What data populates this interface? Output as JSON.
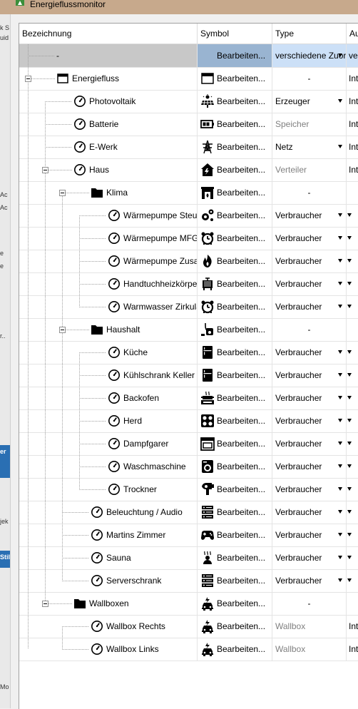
{
  "window": {
    "title": "Energieflussmonitor"
  },
  "columns": [
    "Bezeichnung",
    "Symbol",
    "Type",
    "Au"
  ],
  "rows": [
    {
      "label": "-",
      "symbol": "",
      "edit": "Bearbeiten...",
      "type": "verschiedene Zuordnungen",
      "type_style": "normal",
      "dropdown": true,
      "col4": "ve",
      "col4_dropdown": false
    },
    {
      "label": "Energiefluss",
      "symbol": "window-icon",
      "edit": "Bearbeiten...",
      "type": "-",
      "type_style": "center",
      "dropdown": false,
      "col4": "Int",
      "col4_dropdown": false
    },
    {
      "label": "Photovoltaik",
      "symbol": "solar-panel-icon",
      "edit": "Bearbeiten...",
      "type": "Erzeuger",
      "type_style": "normal",
      "dropdown": true,
      "col4": "Int",
      "col4_dropdown": false
    },
    {
      "label": "Batterie",
      "symbol": "battery-icon",
      "edit": "Bearbeiten...",
      "type": "Speicher",
      "type_style": "gray",
      "dropdown": false,
      "col4": "Int",
      "col4_dropdown": false
    },
    {
      "label": "E-Werk",
      "symbol": "power-tower-icon",
      "edit": "Bearbeiten...",
      "type": "Netz",
      "type_style": "normal",
      "dropdown": true,
      "col4": "Int",
      "col4_dropdown": false
    },
    {
      "label": "Haus",
      "symbol": "house-icon",
      "edit": "Bearbeiten...",
      "type": "Verteiler",
      "type_style": "gray",
      "dropdown": false,
      "col4": "Int",
      "col4_dropdown": false
    },
    {
      "label": "Klima",
      "symbol": "fireplace-icon",
      "edit": "Bearbeiten...",
      "type": "-",
      "type_style": "center",
      "dropdown": false,
      "col4": "",
      "col4_dropdown": false
    },
    {
      "label": "Wärmepumpe Steuerung",
      "symbol": "gears-icon",
      "edit": "Bearbeiten...",
      "type": "Verbraucher",
      "type_style": "normal",
      "dropdown": true,
      "col4": "",
      "col4_dropdown": true
    },
    {
      "label": "Wärmepumpe MFG",
      "symbol": "alarm-clock-icon",
      "edit": "Bearbeiten...",
      "type": "Verbraucher",
      "type_style": "normal",
      "dropdown": true,
      "col4": "",
      "col4_dropdown": true
    },
    {
      "label": "Wärmepumpe Zusatzheizung",
      "symbol": "flame-icon",
      "edit": "Bearbeiten...",
      "type": "Verbraucher",
      "type_style": "normal",
      "dropdown": true,
      "col4": "",
      "col4_dropdown": true
    },
    {
      "label": "Handtuchheizkörper",
      "symbol": "towel-heater-icon",
      "edit": "Bearbeiten...",
      "type": "Verbraucher",
      "type_style": "normal",
      "dropdown": true,
      "col4": "",
      "col4_dropdown": true
    },
    {
      "label": "Warmwasser Zirkulation",
      "symbol": "alarm-clock-icon",
      "edit": "Bearbeiten...",
      "type": "Verbraucher",
      "type_style": "normal",
      "dropdown": true,
      "col4": "",
      "col4_dropdown": true
    },
    {
      "label": "Haushalt",
      "symbol": "vacuum-icon",
      "edit": "Bearbeiten...",
      "type": "-",
      "type_style": "center",
      "dropdown": false,
      "col4": "",
      "col4_dropdown": false
    },
    {
      "label": "Küche",
      "symbol": "fridge-icon",
      "edit": "Bearbeiten...",
      "type": "Verbraucher",
      "type_style": "normal",
      "dropdown": true,
      "col4": "",
      "col4_dropdown": true
    },
    {
      "label": "Kühlschrank Keller",
      "symbol": "fridge-icon",
      "edit": "Bearbeiten...",
      "type": "Verbraucher",
      "type_style": "normal",
      "dropdown": true,
      "col4": "",
      "col4_dropdown": true
    },
    {
      "label": "Backofen",
      "symbol": "cooking-pot-icon",
      "edit": "Bearbeiten...",
      "type": "Verbraucher",
      "type_style": "normal",
      "dropdown": true,
      "col4": "",
      "col4_dropdown": true
    },
    {
      "label": "Herd",
      "symbol": "stove-icon",
      "edit": "Bearbeiten...",
      "type": "Verbraucher",
      "type_style": "normal",
      "dropdown": true,
      "col4": "",
      "col4_dropdown": true
    },
    {
      "label": "Dampfgarer",
      "symbol": "steamer-icon",
      "edit": "Bearbeiten...",
      "type": "Verbraucher",
      "type_style": "normal",
      "dropdown": true,
      "col4": "",
      "col4_dropdown": true
    },
    {
      "label": "Waschmaschine",
      "symbol": "washing-machine-icon",
      "edit": "Bearbeiten...",
      "type": "Verbraucher",
      "type_style": "normal",
      "dropdown": true,
      "col4": "",
      "col4_dropdown": true
    },
    {
      "label": "Trockner",
      "symbol": "hair-dryer-icon",
      "edit": "Bearbeiten...",
      "type": "Verbraucher",
      "type_style": "normal",
      "dropdown": true,
      "col4": "",
      "col4_dropdown": true
    },
    {
      "label": "Beleuchtung / Audio",
      "symbol": "server-rack-icon",
      "edit": "Bearbeiten...",
      "type": "Verbraucher",
      "type_style": "normal",
      "dropdown": true,
      "col4": "",
      "col4_dropdown": true
    },
    {
      "label": "Martins Zimmer",
      "symbol": "gamepad-icon",
      "edit": "Bearbeiten...",
      "type": "Verbraucher",
      "type_style": "normal",
      "dropdown": true,
      "col4": "",
      "col4_dropdown": true
    },
    {
      "label": "Sauna",
      "symbol": "sauna-icon",
      "edit": "Bearbeiten...",
      "type": "Verbraucher",
      "type_style": "normal",
      "dropdown": true,
      "col4": "",
      "col4_dropdown": true
    },
    {
      "label": "Serverschrank",
      "symbol": "server-rack-icon",
      "edit": "Bearbeiten...",
      "type": "Verbraucher",
      "type_style": "normal",
      "dropdown": true,
      "col4": "",
      "col4_dropdown": true
    },
    {
      "label": "Wallboxen",
      "symbol": "car-charging-icon",
      "edit": "Bearbeiten...",
      "type": "-",
      "type_style": "center",
      "dropdown": false,
      "col4": "",
      "col4_dropdown": false
    },
    {
      "label": "Wallbox Rechts",
      "symbol": "car-charging-icon",
      "edit": "Bearbeiten...",
      "type": "Wallbox",
      "type_style": "gray",
      "dropdown": false,
      "col4": "Int",
      "col4_dropdown": false
    },
    {
      "label": "Wallbox Links",
      "symbol": "car-charging-icon",
      "edit": "Bearbeiten...",
      "type": "Wallbox",
      "type_style": "gray",
      "dropdown": false,
      "col4": "Int",
      "col4_dropdown": false
    }
  ],
  "left_panel": {
    "fragments": [
      "k S",
      "uid",
      "Ac",
      "Ac",
      "e",
      "e",
      "r..",
      "jek",
      "er",
      "Stil",
      "Mo"
    ]
  },
  "colors": {
    "titlebar": "#c7a98c",
    "selection_symbol": "#99b4d1",
    "selection_type": "#cce0f7",
    "gray_text": "#808080"
  }
}
